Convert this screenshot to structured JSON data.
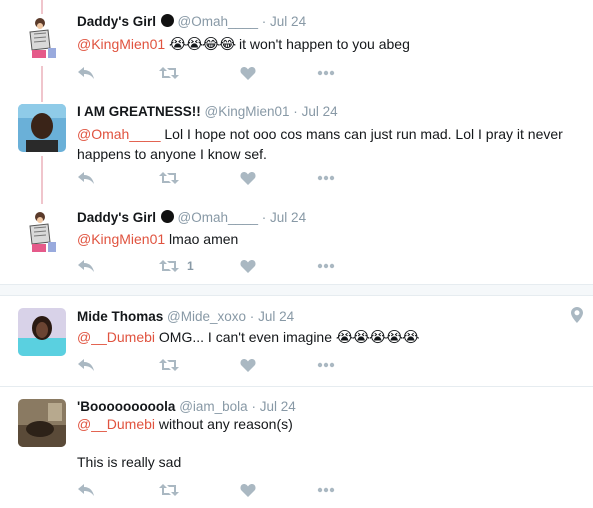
{
  "tweets": [
    {
      "name": "Daddy's Girl",
      "handle": "@Omah____",
      "dot": "·",
      "time": "Jul 24",
      "mention": "@KingMien01",
      "emojis": "😭😭😂😂",
      "text": " it won't happen to you abeg",
      "reply_count": "",
      "retweet_count": "",
      "like_count": ""
    },
    {
      "name": "I AM GREATNESS!!",
      "handle": "@KingMien01",
      "dot": "·",
      "time": "Jul 24",
      "mention": "@Omah____",
      "text": " Lol I hope not ooo cos mans can just run mad. Lol I pray it never happens to anyone I know sef."
    },
    {
      "name": "Daddy's Girl",
      "handle": "@Omah____",
      "dot": "·",
      "time": "Jul 24",
      "mention": "@KingMien01",
      "text": " lmao amen",
      "retweet_count": "1"
    },
    {
      "name": "Mide Thomas",
      "handle": "@Mide_xoxo",
      "dot": "·",
      "time": "Jul 24",
      "mention": "@__Dumebi",
      "text": " OMG... I can't even imagine ",
      "emojis": "😭😭😭😭😭"
    },
    {
      "name": "'Booooooooola",
      "handle": "@iam_bola",
      "dot": "·",
      "time": "Jul 24",
      "mention": "@__Dumebi",
      "text": " without any reason(s)",
      "text2": "This is really sad"
    }
  ],
  "colors": {
    "mention": "#e0533f",
    "meta": "#8899a6",
    "icon": "#aab8c2",
    "thread_line": "#f0c5cc"
  },
  "icons": [
    "reply-icon",
    "retweet-icon",
    "like-icon",
    "more-icon",
    "location-pin-icon"
  ]
}
